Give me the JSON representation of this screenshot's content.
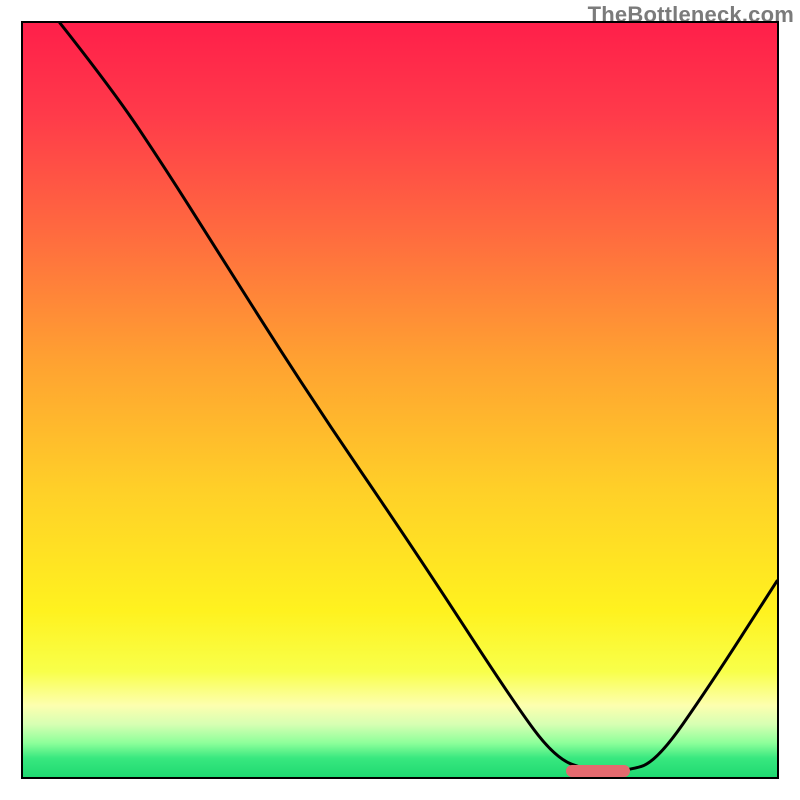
{
  "watermark": "TheBottleneck.com",
  "colors": {
    "border": "#000000",
    "curve": "#000000",
    "marker": "#e46a6f",
    "watermark_text": "#7b7b7b"
  },
  "gradient_stops": [
    {
      "offset": 0.0,
      "color": "#ff1f4a"
    },
    {
      "offset": 0.12,
      "color": "#ff3a4a"
    },
    {
      "offset": 0.28,
      "color": "#ff6b3f"
    },
    {
      "offset": 0.45,
      "color": "#ffa231"
    },
    {
      "offset": 0.62,
      "color": "#ffd028"
    },
    {
      "offset": 0.78,
      "color": "#fff21f"
    },
    {
      "offset": 0.86,
      "color": "#f8ff4a"
    },
    {
      "offset": 0.905,
      "color": "#fdffaf"
    },
    {
      "offset": 0.93,
      "color": "#d7ffb3"
    },
    {
      "offset": 0.955,
      "color": "#8dff9a"
    },
    {
      "offset": 0.975,
      "color": "#38e87f"
    },
    {
      "offset": 1.0,
      "color": "#1fd971"
    }
  ],
  "chart_data": {
    "type": "line",
    "title": "",
    "xlabel": "",
    "ylabel": "",
    "xlim": [
      0,
      100
    ],
    "ylim": [
      0,
      100
    ],
    "grid": false,
    "legend": false,
    "comment": "Axes are unlabeled; x and y values are normalized to percent of plot area. y=100 is top, y=0 is bottom baseline.",
    "series": [
      {
        "name": "bottleneck-curve",
        "x": [
          4.9,
          12.0,
          19.0,
          25.0,
          38.0,
          52.0,
          65.0,
          70.5,
          75.0,
          80.0,
          84.0,
          91.0,
          100.0
        ],
        "y": [
          100.0,
          91.0,
          80.5,
          71.0,
          50.5,
          30.0,
          10.0,
          2.6,
          0.8,
          0.8,
          2.0,
          12.0,
          26.0
        ]
      }
    ],
    "marker": {
      "name": "optimal-range",
      "x_start": 72.0,
      "x_end": 80.5,
      "y": 0.8
    }
  }
}
